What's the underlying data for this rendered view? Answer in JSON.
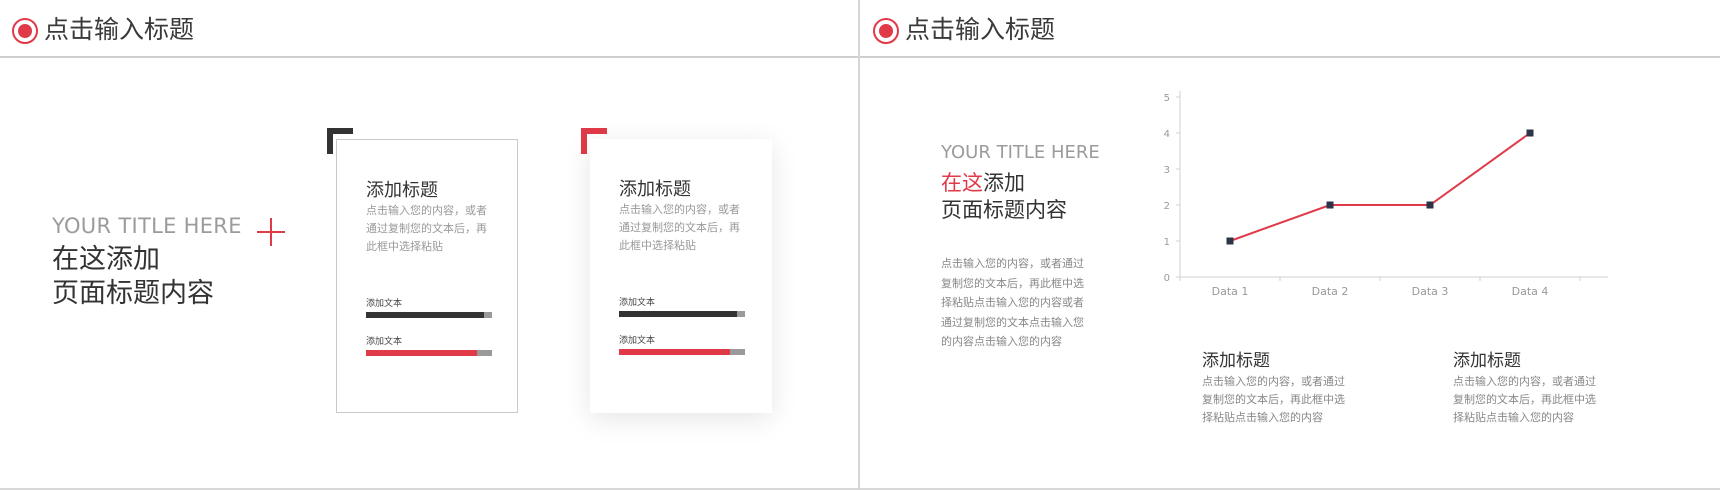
{
  "slide_left": {
    "header_title": "点击输入标题",
    "en_title": "YOUR TITLE HERE",
    "cn_title_line1": "在这添加",
    "cn_title_line2": "页面标题内容",
    "cards": [
      {
        "title": "添加标题",
        "text": "点击输入您的内容，或者通过复制您的文本后，再此框中选择粘贴",
        "corner_color": "#333333",
        "bars": [
          {
            "label": "添加文本",
            "value": 0.94,
            "color": "#333333"
          },
          {
            "label": "添加文本",
            "value": 0.88,
            "color": "#e03a48"
          }
        ]
      },
      {
        "title": "添加标题",
        "text": "点击输入您的内容，或者通过复制您的文本后，再此框中选择粘贴",
        "corner_color": "#e03a48",
        "bars": [
          {
            "label": "添加文本",
            "value": 0.94,
            "color": "#333333"
          },
          {
            "label": "添加文本",
            "value": 0.88,
            "color": "#e03a48"
          }
        ]
      }
    ]
  },
  "slide_right": {
    "header_title": "点击输入标题",
    "en_title": "YOUR TITLE HERE",
    "cn_title_accent": "在这",
    "cn_title_rest": "添加",
    "cn_title_line2": "页面标题内容",
    "body_text": "点击输入您的内容，或者通过复制您的文本后，再此框中选择粘贴点击输入您的内容或者通过复制您的文本点击输入您的内容点击输入您的内容",
    "items": [
      {
        "title": "添加标题",
        "text": "点击输入您的内容，或者通过复制您的文本后，再此框中选择粘贴点击输入您的内容"
      },
      {
        "title": "添加标题",
        "text": "点击输入您的内容，或者通过复制您的文本后，再此框中选择粘贴点击输入您的内容"
      }
    ]
  },
  "colors": {
    "accent": "#e03a48",
    "dark": "#333333",
    "marker": "#2e3447"
  },
  "chart_data": {
    "type": "line",
    "categories": [
      "Data 1",
      "Data 2",
      "Data 3",
      "Data 4"
    ],
    "series": [
      {
        "values": [
          1,
          2,
          2,
          4
        ]
      }
    ],
    "ylim": [
      0,
      5
    ],
    "yticks": [
      0,
      1,
      2,
      3,
      4,
      5
    ],
    "title": "",
    "xlabel": "",
    "ylabel": "",
    "grid": false,
    "legend": "none"
  }
}
